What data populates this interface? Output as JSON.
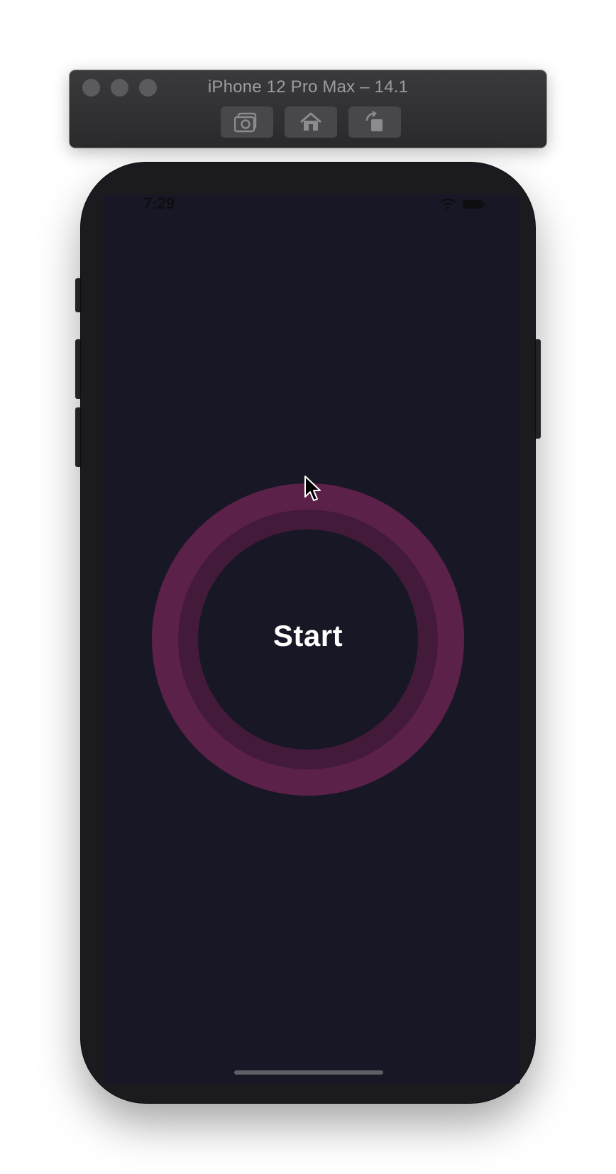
{
  "simulator": {
    "title": "iPhone 12 Pro Max – 14.1",
    "toolbar": [
      {
        "icon": "camera-icon",
        "action": "screenshot"
      },
      {
        "icon": "home-icon",
        "action": "home"
      },
      {
        "icon": "rotate-icon",
        "action": "rotate"
      }
    ]
  },
  "status_bar": {
    "time": "7:29",
    "icons": [
      "wifi-icon",
      "battery-icon"
    ]
  },
  "app": {
    "start_label": "Start"
  },
  "colors": {
    "screen_bg": "#171726",
    "ring_outer": "#5c2149",
    "ring_mid": "#431a3a",
    "label": "#ffffff"
  }
}
